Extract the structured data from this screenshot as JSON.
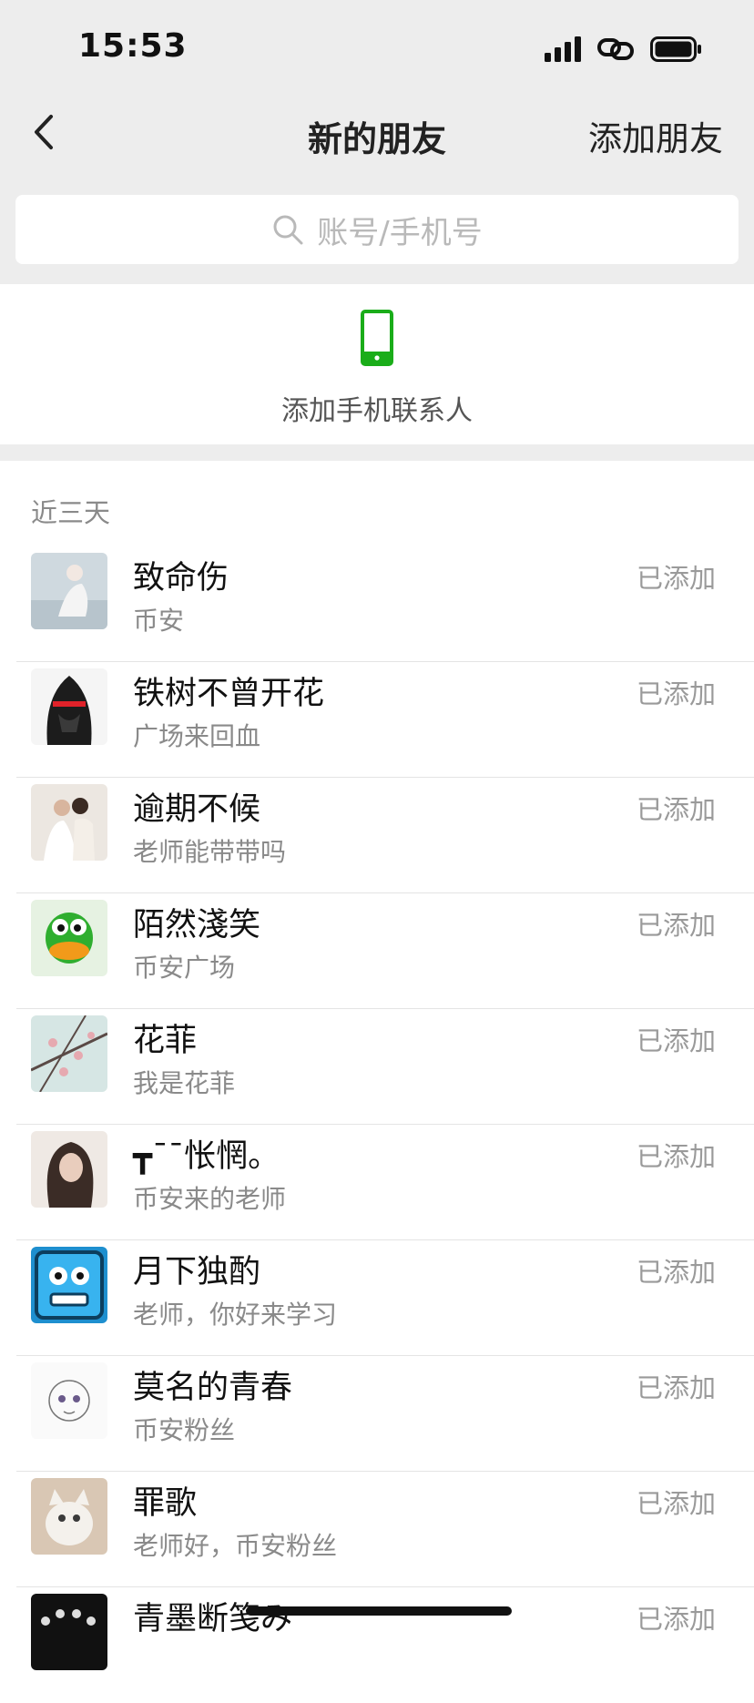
{
  "status_bar": {
    "time": "15:53"
  },
  "nav": {
    "title": "新的朋友",
    "action": "添加朋友"
  },
  "search": {
    "placeholder": "账号/手机号"
  },
  "phone_contacts": {
    "label": "添加手机联系人"
  },
  "section": {
    "title": "近三天"
  },
  "colors": {
    "accent_green": "#1aad19",
    "background_gray": "#ededed"
  },
  "friends": [
    {
      "name": "致命伤",
      "message": "币安",
      "status": "已添加"
    },
    {
      "name": "铁树不曾开花",
      "message": "广场来回血",
      "status": "已添加"
    },
    {
      "name": "逾期不候",
      "message": "老师能带带吗",
      "status": "已添加"
    },
    {
      "name": "陌然淺笑",
      "message": "币安广场",
      "status": "已添加"
    },
    {
      "name": "花菲",
      "message": "我是花菲",
      "status": "已添加"
    },
    {
      "name": "┳ˉ¯怅惘。",
      "message": "币安来的老师",
      "status": "已添加"
    },
    {
      "name": "月下独酌",
      "message": "老师，你好来学习",
      "status": "已添加"
    },
    {
      "name": "莫名的青春",
      "message": "币安粉丝",
      "status": "已添加"
    },
    {
      "name": "罪歌",
      "message": "老师好，币安粉丝",
      "status": "已添加"
    },
    {
      "name": "青墨断笺み",
      "message": "",
      "status": "已添加"
    }
  ]
}
